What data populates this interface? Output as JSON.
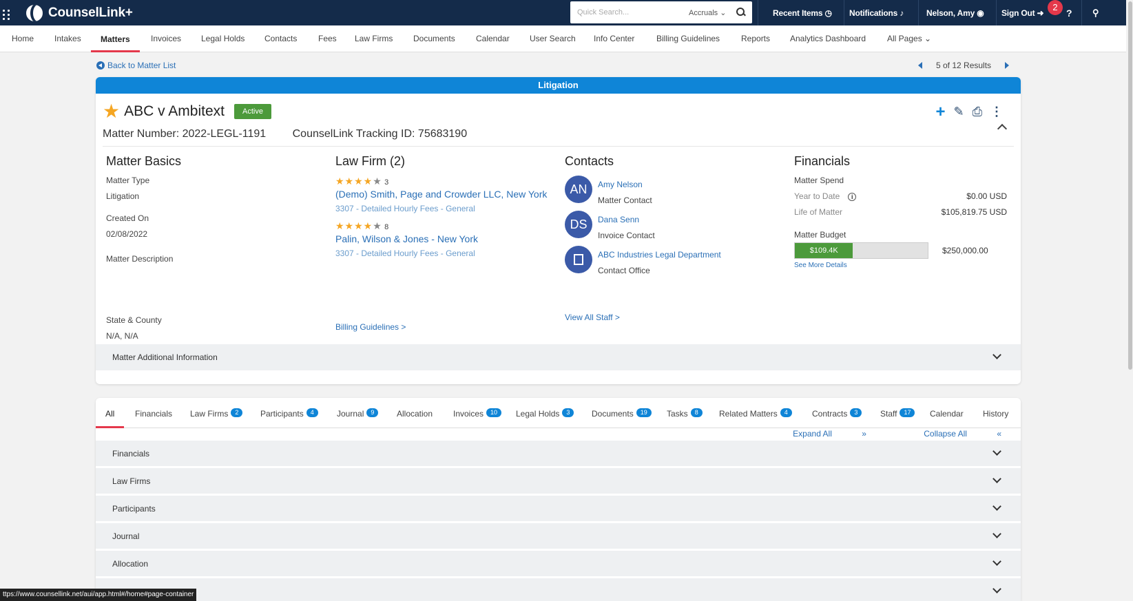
{
  "app": {
    "title": "CounselLink+"
  },
  "search": {
    "placeholder": "Quick Search...",
    "filter": "Accruals"
  },
  "topnav": {
    "recent_items": "Recent Items",
    "notifications": "Notifications",
    "user": "Nelson, Amy",
    "sign_out": "Sign Out",
    "notification_count": "2"
  },
  "mainnav": [
    "Home",
    "Intakes",
    "Matters",
    "Invoices",
    "Legal Holds",
    "Contacts",
    "Fees",
    "Law Firms",
    "Documents",
    "Calendar",
    "User Search",
    "Info Center",
    "Billing Guidelines",
    "Reports",
    "Analytics Dashboard",
    "All Pages"
  ],
  "back_link": "Back to Matter List",
  "pager": "5 of 12 Results",
  "matter": {
    "category": "Litigation",
    "name": "ABC v Ambitext",
    "status": "Active",
    "number": "Matter Number: 2022-LEGL-1191",
    "tracking": "CounselLink Tracking ID: 75683190"
  },
  "basics": {
    "heading": "Matter Basics",
    "type_label": "Matter Type",
    "type_value": "Litigation",
    "created_label": "Created On",
    "created_value": "02/08/2022",
    "description_label": "Matter Description",
    "state_label": "State & County",
    "state_value": "N/A, N/A"
  },
  "law_firms": {
    "heading": "Law Firm (2)",
    "items": [
      {
        "rating_count": "3",
        "name": "(Demo) Smith, Page and Crowder LLC, New York",
        "detail": "3307 - Detailed Hourly Fees - General",
        "stars": 4.5
      },
      {
        "rating_count": "8",
        "name": "Palin, Wilson & Jones - New York",
        "detail": "3307 - Detailed Hourly Fees - General",
        "stars": 3.5
      }
    ],
    "billing_link": "Billing Guidelines >"
  },
  "contacts": {
    "heading": "Contacts",
    "items": [
      {
        "initials": "AN",
        "name": "Amy Nelson",
        "role": "Matter Contact"
      },
      {
        "initials": "DS",
        "name": "Dana Senn",
        "role": "Invoice Contact"
      },
      {
        "initials": "",
        "name": "ABC Industries Legal Department",
        "role": "Contact Office"
      }
    ],
    "view_all": "View All Staff >"
  },
  "financials": {
    "heading": "Financials",
    "spend_label": "Matter Spend",
    "ytd_label": "Year to Date",
    "ytd_value": "$0.00 USD",
    "life_label": "Life of Matter",
    "life_value": "$105,819.75 USD",
    "budget_label": "Matter Budget",
    "budget_used": "$109.4K",
    "budget_total": "$250,000.00",
    "budget_fraction": 0.4376,
    "see_more": "See More Details"
  },
  "additional_info": "Matter Additional Information",
  "tabs": [
    {
      "label": "All",
      "count": ""
    },
    {
      "label": "Financials",
      "count": ""
    },
    {
      "label": "Law Firms",
      "count": "2"
    },
    {
      "label": "Participants",
      "count": "4"
    },
    {
      "label": "Journal",
      "count": "9"
    },
    {
      "label": "Allocation",
      "count": ""
    },
    {
      "label": "Invoices",
      "count": "10"
    },
    {
      "label": "Legal Holds",
      "count": "3"
    },
    {
      "label": "Documents",
      "count": "19"
    },
    {
      "label": "Tasks",
      "count": "8"
    },
    {
      "label": "Related Matters",
      "count": "4"
    },
    {
      "label": "Contracts",
      "count": "3"
    },
    {
      "label": "Staff",
      "count": "17"
    },
    {
      "label": "Calendar",
      "count": ""
    },
    {
      "label": "History",
      "count": ""
    }
  ],
  "expand_all": "Expand All",
  "collapse_all": "Collapse All",
  "sections": [
    "Financials",
    "Law Firms",
    "Participants",
    "Journal",
    "Allocation"
  ],
  "status_url": "ttps://www.counsellink.net/aui/app.html#/home#page-container",
  "colors": {
    "topbar": "#142b4a",
    "accent_blue": "#0f85d7",
    "active_green": "#4c9a3b",
    "tab_red": "#e4384b"
  }
}
